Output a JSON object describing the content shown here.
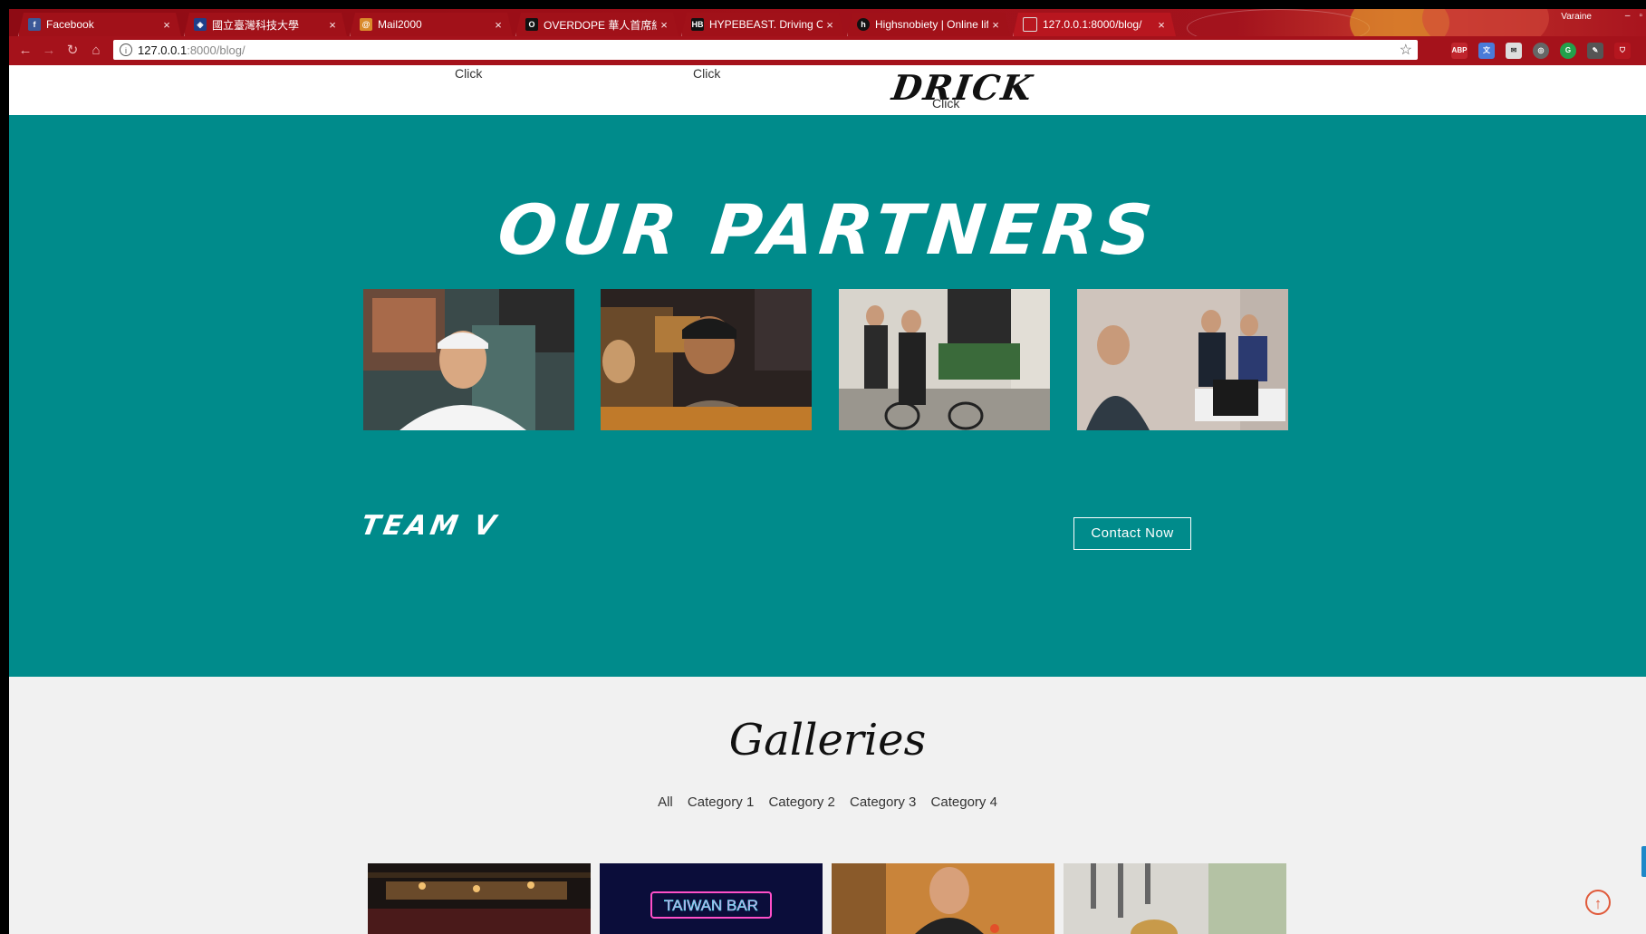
{
  "browser": {
    "tabs": [
      {
        "title": "Facebook",
        "favicon": "facebook-icon",
        "color": "#3b5998"
      },
      {
        "title": "國立臺灣科技大學",
        "favicon": "university-icon",
        "color": "#1f3f8a"
      },
      {
        "title": "Mail2000",
        "favicon": "mail2000-icon",
        "color": "#d98a2b"
      },
      {
        "title": "OVERDOPE 華人首席線上",
        "favicon": "overdope-icon",
        "color": "#111111"
      },
      {
        "title": "HYPEBEAST. Driving Cult",
        "favicon": "hypebeast-icon",
        "color": "#111111"
      },
      {
        "title": "Highsnobiety | Online life",
        "favicon": "highsnobiety-icon",
        "color": "#111111"
      },
      {
        "title": "127.0.0.1:8000/blog/",
        "favicon": "page-icon",
        "color": "#cccccc"
      }
    ],
    "profile": "Varaine",
    "url_host": "127.0.0.1",
    "url_path": ":8000/blog/",
    "close_glyph": "×"
  },
  "nav": {
    "click_labels": [
      "Click",
      "Click",
      "Click"
    ],
    "brand": "DRICK"
  },
  "partners": {
    "title": "OUR PARTNERS",
    "team_label": "TEAM V",
    "contact_label": "Contact Now"
  },
  "galleries": {
    "title": "Galleries",
    "filters": [
      "All",
      "Category 1",
      "Category 2",
      "Category 3",
      "Category 4"
    ],
    "neon_sign": "TAIWAN BAR"
  },
  "colors": {
    "tabbar": "#9f0f18",
    "teal": "#008b8b",
    "gallery_bg": "#f1f1f1",
    "scroll_up": "#e05a3a"
  }
}
